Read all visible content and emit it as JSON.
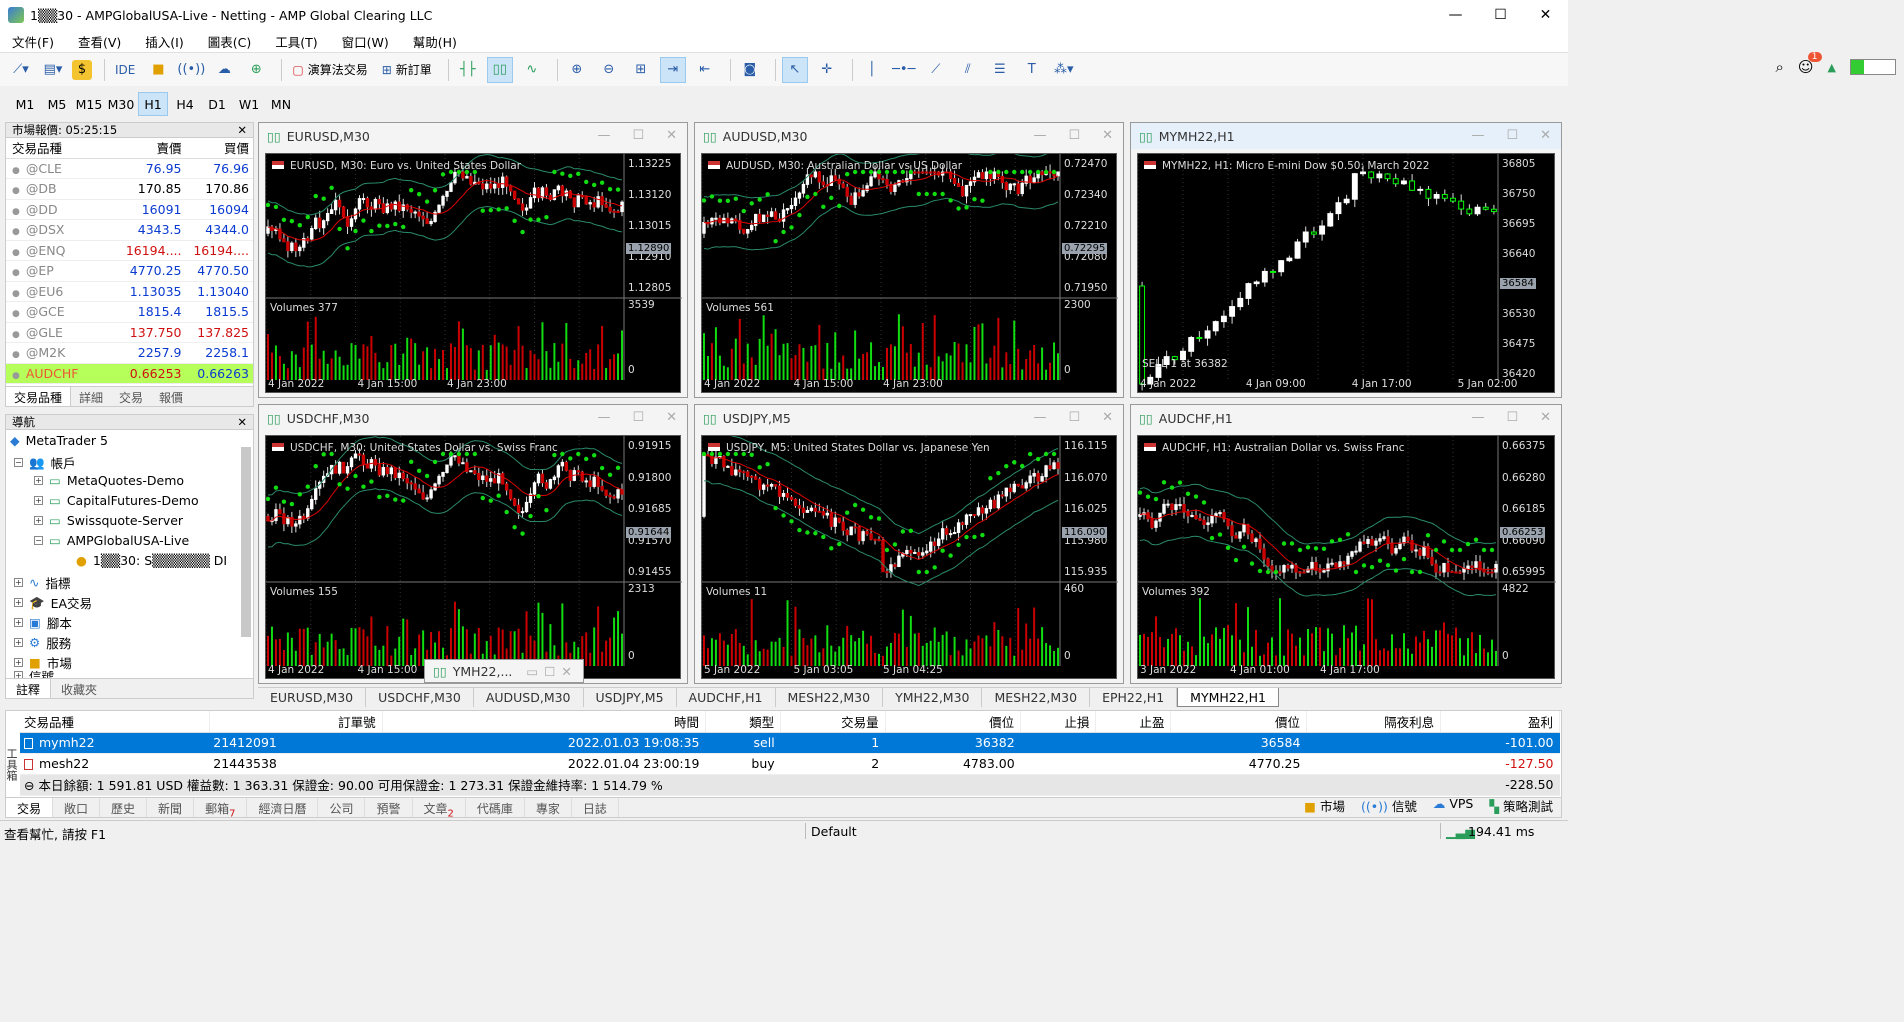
{
  "window": {
    "title": "1▒▒30 - AMPGlobalUSA-Live - Netting - AMP Global Clearing LLC",
    "min": "—",
    "max": "☐",
    "close": "✕"
  },
  "menu": [
    "文件(F)",
    "查看(V)",
    "插入(I)",
    "圖表(C)",
    "工具(T)",
    "窗口(W)",
    "幫助(H)"
  ],
  "toolbar": {
    "ide": "IDE",
    "algo": "演算法交易",
    "neworder": "新訂單"
  },
  "timeframes": [
    "M1",
    "M5",
    "M15",
    "M30",
    "H1",
    "H4",
    "D1",
    "W1",
    "MN"
  ],
  "selected_tf": "H1",
  "notify_count": "1",
  "market_watch": {
    "header": "市場報價: 05:25:15",
    "col_sym": "交易品種",
    "col_bid": "賣價",
    "col_ask": "買價",
    "rows": [
      {
        "sym": "@CLE",
        "bid": "76.95",
        "ask": "76.96",
        "color": "blue"
      },
      {
        "sym": "@DB",
        "bid": "170.85",
        "ask": "170.86",
        "color": "black"
      },
      {
        "sym": "@DD",
        "bid": "16091",
        "ask": "16094",
        "color": "blue"
      },
      {
        "sym": "@DSX",
        "bid": "4343.5",
        "ask": "4344.0",
        "color": "blue"
      },
      {
        "sym": "@ENQ",
        "bid": "16194....",
        "ask": "16194....",
        "color": "red"
      },
      {
        "sym": "@EP",
        "bid": "4770.25",
        "ask": "4770.50",
        "color": "blue"
      },
      {
        "sym": "@EU6",
        "bid": "1.13035",
        "ask": "1.13040",
        "color": "blue"
      },
      {
        "sym": "@GCE",
        "bid": "1815.4",
        "ask": "1815.5",
        "color": "blue"
      },
      {
        "sym": "@GLE",
        "bid": "137.750",
        "ask": "137.825",
        "color": "red"
      },
      {
        "sym": "@M2K",
        "bid": "2257.9",
        "ask": "2258.1",
        "color": "blue"
      },
      {
        "sym": "AUDCHF",
        "bid": "0.66253",
        "ask": "0.66263",
        "color": "hl"
      }
    ],
    "tabs": [
      "交易品種",
      "詳細",
      "交易",
      "報價"
    ]
  },
  "navigator": {
    "header": "導航",
    "root": "MetaTrader 5",
    "accounts": "帳戶",
    "acc1": "MetaQuotes-Demo",
    "acc2": "CapitalFutures-Demo",
    "acc3": "Swissquote-Server",
    "acc4": "AMPGlobalUSA-Live",
    "user": "1▒▒30: S▒▒▒▒▒▒ DI",
    "indicators": "指標",
    "ea": "EA交易",
    "scripts": "腳本",
    "services": "服務",
    "market": "市場",
    "signals": "信號",
    "tabs": [
      "註釋",
      "收藏夾"
    ]
  },
  "charts": [
    {
      "tab": "EURUSD,M30",
      "desc": "EURUSD, M30:  Euro vs. United States Dollar",
      "prices": [
        "1.13225",
        "1.13120",
        "1.13015",
        "1.12910",
        "1.12805"
      ],
      "cur": "1.12890",
      "vol": "Volumes 377",
      "vmax": "3539",
      "vmin": "0",
      "times": [
        "4 Jan 2022",
        "4 Jan 15:00",
        "4 Jan 23:00"
      ]
    },
    {
      "tab": "AUDUSD,M30",
      "desc": "AUDUSD, M30:  Australian Dollar vs US Dollar",
      "prices": [
        "0.72470",
        "0.72340",
        "0.72210",
        "0.72080",
        "0.71950"
      ],
      "cur": "0.72295",
      "vol": "Volumes 561",
      "vmax": "2300",
      "vmin": "0",
      "times": [
        "4 Jan 2022",
        "4 Jan 15:00",
        "4 Jan 23:00"
      ]
    },
    {
      "tab": "MYMH22,H1",
      "desc": "MYMH22, H1:  Micro E-mini Dow $0.50: March 2022",
      "prices": [
        "36805",
        "36750",
        "36695",
        "36640",
        "36584",
        "36530",
        "36475",
        "36420"
      ],
      "cur": "36584",
      "vol": "SELL 1 at 36382",
      "vmax": "",
      "vmin": "",
      "times": [
        "4 Jan 2022",
        "4 Jan 09:00",
        "4 Jan 17:00",
        "5 Jan 02:00"
      ]
    },
    {
      "tab": "USDCHF,M30",
      "desc": "USDCHF, M30:  United States Dollar vs. Swiss Franc",
      "prices": [
        "0.91915",
        "0.91800",
        "0.91685",
        "0.91570",
        "0.91455"
      ],
      "cur": "0.91644",
      "vol": "Volumes 155",
      "vmax": "2313",
      "vmin": "0",
      "times": [
        "4 Jan 2022",
        "4 Jan 15:00"
      ]
    },
    {
      "tab": "USDJPY,M5",
      "desc": "USDJPY, M5:  United States Dollar vs. Japanese Yen",
      "prices": [
        "116.115",
        "116.070",
        "116.025",
        "115.980",
        "115.935"
      ],
      "cur": "116.090",
      "vol": "Volumes 11",
      "vmax": "460",
      "vmin": "0",
      "times": [
        "5 Jan 2022",
        "5 Jan 03:05",
        "5 Jan 04:25"
      ]
    },
    {
      "tab": "AUDCHF,H1",
      "desc": "AUDCHF, H1:  Australian Dollar vs. Swiss Franc",
      "prices": [
        "0.66375",
        "0.66280",
        "0.66185",
        "0.66090",
        "0.65995"
      ],
      "cur": "0.66253",
      "vol": "Volumes 392",
      "vmax": "4822",
      "vmin": "0",
      "times": [
        "3 Jan 2022",
        "4 Jan 01:00",
        "4 Jan 17:00"
      ]
    }
  ],
  "mini_window": "YMH22,...",
  "chart_tabs": [
    "EURUSD,M30",
    "USDCHF,M30",
    "AUDUSD,M30",
    "USDJPY,M5",
    "AUDCHF,H1",
    "MESH22,M30",
    "YMH22,M30",
    "MESH22,M30",
    "EPH22,H1",
    "MYMH22,H1"
  ],
  "active_chart_tab": "MYMH22,H1",
  "terminal": {
    "cols": [
      "交易品種",
      "訂單號",
      "時間",
      "類型",
      "交易量",
      "價位",
      "止損",
      "止盈",
      "價位",
      "隔夜利息",
      "盈利"
    ],
    "rows": [
      {
        "sym": "mymh22",
        "order": "21412091",
        "time": "2022.01.03 19:08:35",
        "type": "sell",
        "vol": "1",
        "price": "36382",
        "sl": "",
        "tp": "",
        "cur": "36584",
        "swap": "",
        "profit": "-101.00"
      },
      {
        "sym": "mesh22",
        "order": "21443538",
        "time": "2022.01.04 23:00:19",
        "type": "buy",
        "vol": "2",
        "price": "4783.00",
        "sl": "",
        "tp": "",
        "cur": "4770.25",
        "swap": "",
        "profit": "-127.50"
      }
    ],
    "summary": "本日餘額: 1 591.81 USD  權益數: 1 363.31  保證金: 90.00  可用保證金: 1 273.31  保證金維持率: 1 514.79 %",
    "summary_profit": "-228.50",
    "tabs": [
      "交易",
      "敞口",
      "歷史",
      "新聞",
      "郵箱",
      "經濟日曆",
      "公司",
      "預警",
      "文章",
      "代碼庫",
      "專家",
      "日誌"
    ],
    "mail_badge": "7",
    "article_badge": "2",
    "right_tabs": [
      "市場",
      "信號",
      "VPS",
      "策略測試"
    ],
    "side_label": "工具箱"
  },
  "status": {
    "help": "查看幫忙, 請按 F1",
    "profile": "Default",
    "ping": "194.41 ms"
  }
}
